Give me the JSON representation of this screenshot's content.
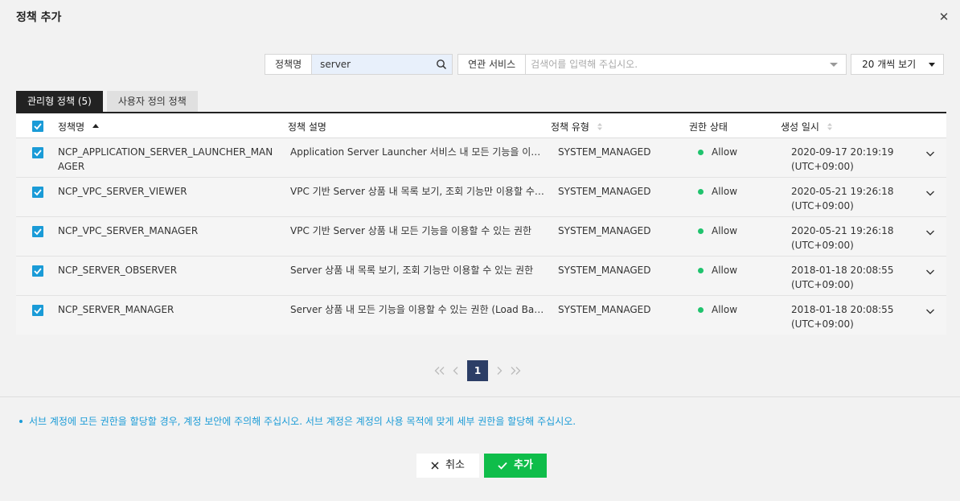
{
  "dialog": {
    "title": "정책 추가"
  },
  "filters": {
    "name_label": "정책명",
    "name_value": "server",
    "service_label": "연관 서비스",
    "service_placeholder": "검색어를 입력해 주십시오.",
    "page_size": "20 개씩 보기"
  },
  "tabs": [
    {
      "label": "관리형 정책 (5)",
      "active": true
    },
    {
      "label": "사용자 정의 정책",
      "active": false
    }
  ],
  "table": {
    "headers": {
      "name": "정책명",
      "desc": "정책 설명",
      "type": "정책 유형",
      "status": "권한 상태",
      "created": "생성 일시"
    },
    "rows": [
      {
        "name": "NCP_APPLICATION_SERVER_LAUNCHER_MANAGER",
        "desc": "Application Server Launcher 서비스 내 모든 기능을 이용할 수 있는 권한",
        "type": "SYSTEM_MANAGED",
        "status": "Allow",
        "date": "2020-09-17 20:19:19",
        "tz": "(UTC+09:00)"
      },
      {
        "name": "NCP_VPC_SERVER_VIEWER",
        "desc": "VPC 기반 Server 상품 내 목록 보기, 조회 기능만 이용할 수 있는 권한",
        "type": "SYSTEM_MANAGED",
        "status": "Allow",
        "date": "2020-05-21 19:26:18",
        "tz": "(UTC+09:00)"
      },
      {
        "name": "NCP_VPC_SERVER_MANAGER",
        "desc": "VPC 기반 Server 상품 내 모든 기능을 이용할 수 있는 권한",
        "type": "SYSTEM_MANAGED",
        "status": "Allow",
        "date": "2020-05-21 19:26:18",
        "tz": "(UTC+09:00)"
      },
      {
        "name": "NCP_SERVER_OBSERVER",
        "desc": "Server 상품 내 목록 보기, 조회 기능만 이용할 수 있는 권한",
        "type": "SYSTEM_MANAGED",
        "status": "Allow",
        "date": "2018-01-18 20:08:55",
        "tz": "(UTC+09:00)"
      },
      {
        "name": "NCP_SERVER_MANAGER",
        "desc": "Server 상품 내 모든 기능을 이용할 수 있는 권한 (Load Balancer 포함)",
        "type": "SYSTEM_MANAGED",
        "status": "Allow",
        "date": "2018-01-18 20:08:55",
        "tz": "(UTC+09:00)"
      }
    ]
  },
  "pagination": {
    "current": "1"
  },
  "notice": "서브 계정에 모든 권한을 할당할 경우, 계정 보안에 주의해 주십시오. 서브 계정은 계정의 사용 목적에 맞게 세부 권한을 할당해 주십시오.",
  "buttons": {
    "cancel": "취소",
    "add": "추가"
  },
  "colors": {
    "accent": "#1a9bd7",
    "primary_button": "#0fbd4a",
    "pager_active": "#2c3e66",
    "status_allow": "#1fc36d"
  }
}
